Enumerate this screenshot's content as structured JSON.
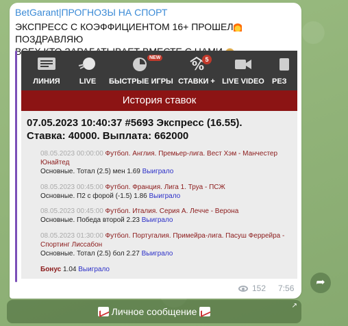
{
  "post": {
    "channel": "BetGarant|ПРОГНОЗЫ НА СПОРТ",
    "line1": "ЭКСПРЕСС С КОЭФФИЦИЕНТОМ 16+ ПРОШЕЛ",
    "line1b": " ПОЗДРАВЛЯЮ",
    "line2": "ВСЕХ КТО ЗАРАБАТЫВАЕТ ВМЕСТЕ С НАМИ",
    "views": "152",
    "time": "7:56"
  },
  "screenshot": {
    "nav": [
      {
        "label": "ЛИНИЯ",
        "icon": "list-icon"
      },
      {
        "label": "LIVE",
        "icon": "ball-icon"
      },
      {
        "label": "БЫСТРЫЕ ИГРЫ",
        "icon": "clock-icon",
        "badge": "NEW"
      },
      {
        "label": "СТАВКИ +",
        "icon": "percent-icon",
        "badge": "5"
      },
      {
        "label": "LIVE VIDEO",
        "icon": "video-icon"
      },
      {
        "label": "РЕЗ",
        "icon": "more-icon"
      }
    ],
    "section_title": "История ставок",
    "headline1": "07.05.2023 10:40:37 #5693 Экспресс (16.55).",
    "headline2": "Ставка: 40000. Выплата: 662000",
    "bets": [
      {
        "date": "08.05.2023 00:00:00",
        "event": "Футбол. Англия. Премьер-лига. Вест Хэм - Манчестер Юнайтед",
        "detail": "Основные. Тотал (2.5) мен 1.69",
        "status": "Выиграло"
      },
      {
        "date": "08.05.2023 00:45:00",
        "event": "Футбол. Франция. Лига 1. Труа - ПСЖ",
        "detail": "Основные. П2 с форой (-1.5) 1.86",
        "status": "Выиграло"
      },
      {
        "date": "08.05.2023 00:45:00",
        "event": "Футбол. Италия. Серия А. Лечче - Верона",
        "detail": "Основные. Победа второй 2.23",
        "status": "Выиграло"
      },
      {
        "date": "08.05.2023 01:30:00",
        "event": "Футбол. Португалия. Примейра-лига. Пасуш Феррейра - Спортинг Лиссабон",
        "detail": "Основные. Тотал (2.5) бол 2.27",
        "status": "Выиграло"
      }
    ],
    "bonus_label": "Бонус",
    "bonus_value": "1.04",
    "bonus_status": "Выиграло"
  },
  "inline_button": {
    "label": "Личное сообщение"
  },
  "colors": {
    "channel_name": "#3a8ad6",
    "red_bar": "#8c1414",
    "win": "#2b2fc8",
    "event": "#8b1a1a"
  }
}
